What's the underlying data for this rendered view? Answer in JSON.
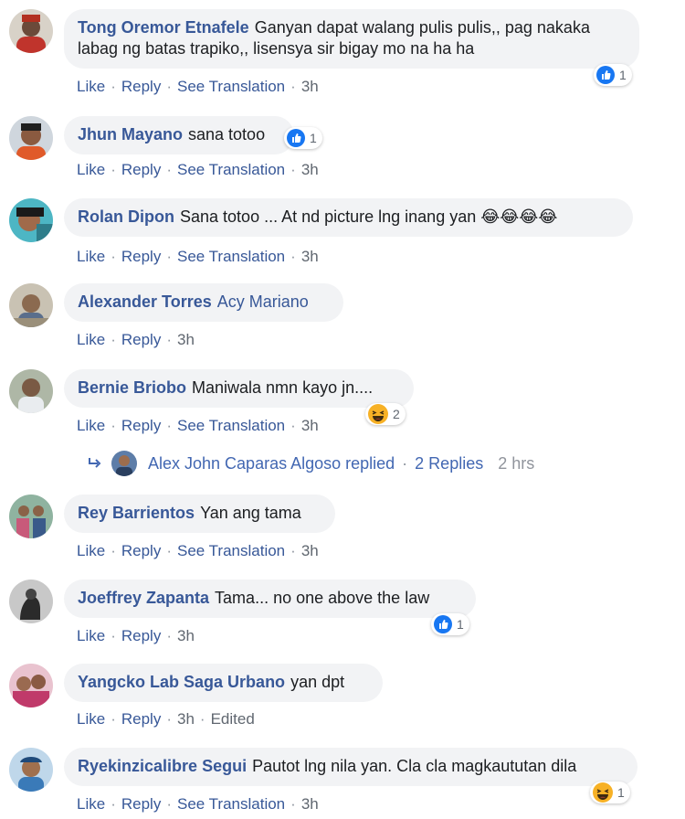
{
  "comments": [
    {
      "author": "Tong Oremor Etnafele",
      "text": "Ganyan dapat walang pulis pulis,, pag nakaka labag ng batas trapiko,, lisensya sir bigay mo na ha ha",
      "reaction_count": "1",
      "actions": {
        "like": "Like",
        "reply": "Reply",
        "translate": "See Translation",
        "time": "3h"
      }
    },
    {
      "author": "Jhun Mayano",
      "text": "sana totoo",
      "reaction_count": "1",
      "actions": {
        "like": "Like",
        "reply": "Reply",
        "translate": "See Translation",
        "time": "3h"
      }
    },
    {
      "author": "Rolan Dipon",
      "text": "Sana totoo ... At nd picture lng inang yan 😂😂😂😂",
      "actions": {
        "like": "Like",
        "reply": "Reply",
        "translate": "See Translation",
        "time": "3h"
      }
    },
    {
      "author": "Alexander Torres",
      "tagged": "Acy Mariano",
      "actions": {
        "like": "Like",
        "reply": "Reply",
        "time": "3h"
      }
    },
    {
      "author": "Bernie Briobo",
      "text": "Maniwala nmn kayo jn....",
      "reaction_count": "2",
      "actions": {
        "like": "Like",
        "reply": "Reply",
        "translate": "See Translation",
        "time": "3h"
      }
    },
    {
      "author": "Rey Barrientos",
      "text": "Yan ang tama",
      "actions": {
        "like": "Like",
        "reply": "Reply",
        "translate": "See Translation",
        "time": "3h"
      }
    },
    {
      "author": "Joeffrey Zapanta",
      "text": "Tama... no one above the law",
      "reaction_count": "1",
      "actions": {
        "like": "Like",
        "reply": "Reply",
        "time": "3h"
      }
    },
    {
      "author": "Yangcko Lab Saga Urbano",
      "text": "yan dpt",
      "actions": {
        "like": "Like",
        "reply": "Reply",
        "time": "3h",
        "edited": "Edited"
      }
    },
    {
      "author": "Ryekinzicalibre Segui",
      "text": "Pautot lng nila yan. Cla cla magkaututan dila",
      "reaction_count": "1",
      "actions": {
        "like": "Like",
        "reply": "Reply",
        "translate": "See Translation",
        "time": "3h"
      }
    }
  ],
  "replies_row": {
    "text": "Alex John Caparas Algoso replied",
    "count_label": "2 Replies",
    "time": "2 hrs"
  },
  "icons": {
    "like": "like-reaction-icon",
    "haha": "haha-reaction-icon",
    "reply_arrow": "reply-arrow-icon"
  },
  "colors": {
    "link": "#385898",
    "bubble": "#f2f3f5",
    "like_blue": "#1877f2",
    "haha_yellow": "#f7b125"
  }
}
